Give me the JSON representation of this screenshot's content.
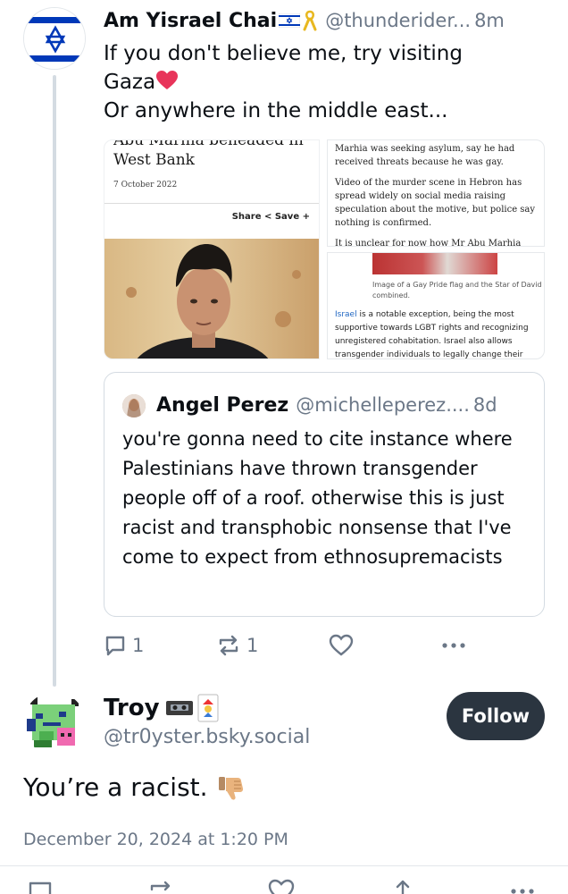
{
  "parent_post": {
    "display_name": "Am Yisrael Chai",
    "handle": "@thunderider...",
    "time": "8m",
    "text_line1": "If you don't believe me, try visiting",
    "text_line2": "Gaza",
    "text_line3": "Or anywhere in the middle east...",
    "avatar_icon": "israel-flag-icon",
    "images": {
      "left": {
        "headline_cut": "Abu Marhia beheaded in",
        "headline": "West Bank",
        "date": "7 October 2022",
        "share_label": "Share",
        "save_label": "Save"
      },
      "right_top": {
        "para1": "Marhia was seeking asylum, say he had received threats because he was gay.",
        "para2": "Video of the murder scene in Hebron has spread widely on social media raising speculation about the motive, but police say nothing is confirmed.",
        "para3": "It is unclear for now how Mr Abu Marhia"
      },
      "right_bottom": {
        "caption": "Image of a Gay Pride flag and the Star of David combined.",
        "link_word": "Israel",
        "body": " is a notable exception, being the most supportive towards LGBT rights and recognizing unregistered cohabitation. Israel also allows transgender individuals to legally change their"
      }
    },
    "quote": {
      "display_name": "Angel Perez",
      "handle": "@michelleperez....",
      "time": "8d",
      "text": "you're gonna need to cite instance where Palestinians have thrown transgender people off of a roof. otherwise this is just racist and transphobic nonsense that I've come to expect from ethnosupremacists"
    },
    "actions": {
      "reply_count": "1",
      "repost_count": "1"
    }
  },
  "reply_post": {
    "display_name": "Troy",
    "handle": "@tr0yster.bsky.social",
    "follow_label": "Follow",
    "text": "You’re a racist.",
    "date": "December 20, 2024 at 1:20 PM"
  },
  "colors": {
    "text": "#0b0f14",
    "muted": "#6b7787",
    "border": "#d4dbe2",
    "follow_bg": "#2b3540",
    "israel_blue": "#0038b8",
    "heart": "#e8345a",
    "link": "#1f66c2"
  }
}
